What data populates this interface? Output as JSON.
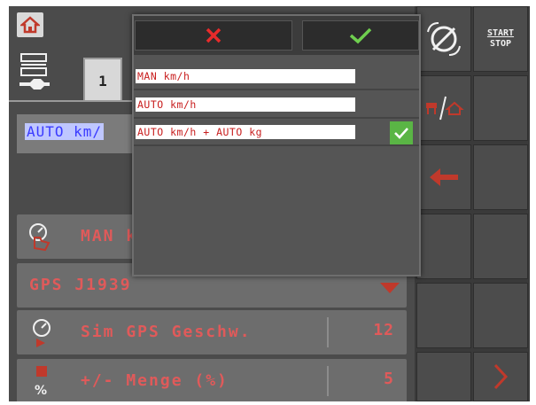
{
  "colors": {
    "label_red": "#e05a5a",
    "option_text_red": "#c81e1e",
    "cancel_red": "#e82b2b",
    "confirm_green": "#6fcf4f",
    "selected_bg": "#5ab545"
  },
  "header": {
    "home_icon": "home-icon",
    "tab_label": "1",
    "settings_icon": "wrench-settings-icon"
  },
  "background_field": {
    "text": "AUTO km/"
  },
  "rows": [
    {
      "icon": "hand-speed-icon",
      "label": "MAN k"
    },
    {
      "icon": "",
      "label": "GPS J1939"
    },
    {
      "icon": "speedometer-sim-icon",
      "label": "Sim GPS Geschw.",
      "value": "12"
    },
    {
      "icon": "weight-percent-icon",
      "label": "+/- Menge (%)",
      "value": "5"
    }
  ],
  "dialog": {
    "cancel_icon": "cancel-x-icon",
    "confirm_icon": "checkmark-icon",
    "options": [
      {
        "label": "MAN km/h",
        "selected": false
      },
      {
        "label": "AUTO km/h",
        "selected": false
      },
      {
        "label": "AUTO km/h + AUTO kg",
        "selected": true
      }
    ]
  },
  "right_panel": {
    "start_stop_line1": "START",
    "start_stop_line2": "STOP",
    "icons": [
      "section-disable-icon",
      "cart-home-icon",
      "back-arrow-icon",
      "next-chevron-icon"
    ]
  }
}
